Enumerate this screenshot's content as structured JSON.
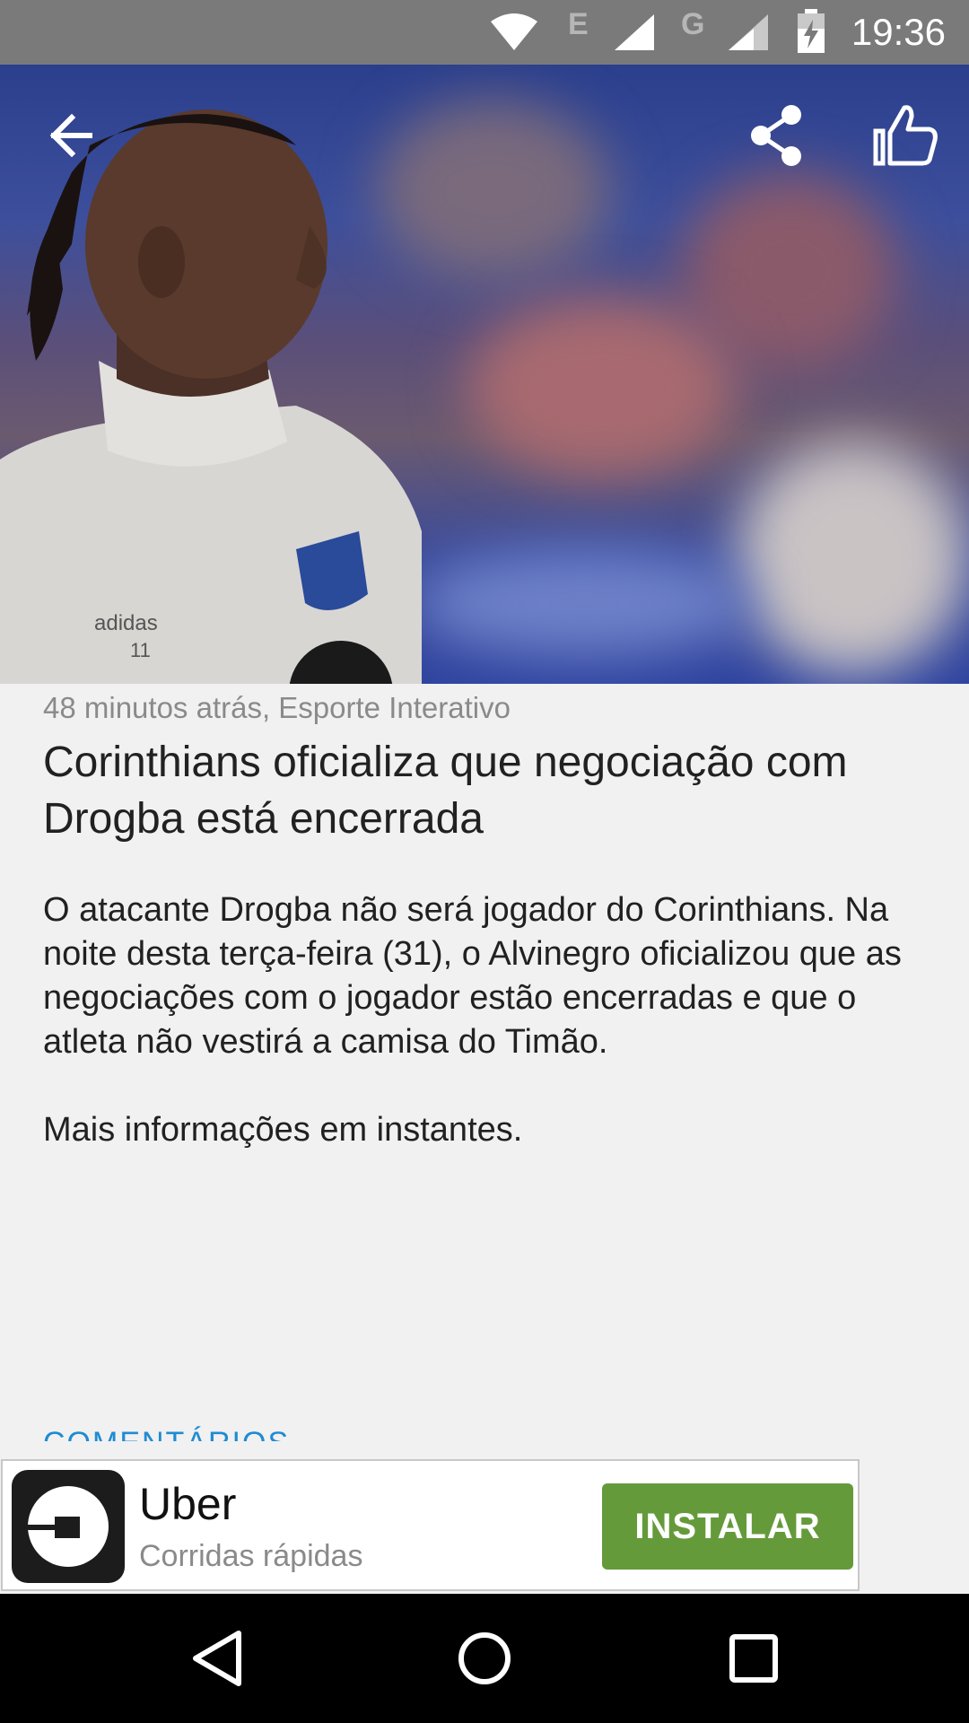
{
  "status_bar": {
    "time": "19:36",
    "network_letters": [
      "E",
      "G"
    ],
    "icons": [
      "wifi-icon",
      "signal-icon",
      "battery-charging-icon"
    ]
  },
  "hero": {
    "icons": [
      "back-arrow-icon",
      "share-icon",
      "thumbs-up-icon"
    ],
    "jersey_text": "adidas",
    "jersey_number": "11"
  },
  "article": {
    "meta": "48 minutos atrás, Esporte Interativo",
    "title": "Corinthians oficializa que negociação com Drogba está encerrada",
    "paragraphs": [
      "O atacante Drogba não será jogador do Corinthians. Na noite desta terça-feira (31), o Alvinegro oficializou que as negociações com o jogador estão encerradas e que o atleta não vestirá a camisa do Timão.",
      "Mais informações em instantes."
    ],
    "comments_label": "COMENTÁRIOS"
  },
  "ad": {
    "app_name": "Uber",
    "tagline": "Corridas rápidas",
    "install_label": "INSTALAR",
    "button_color": "#659a3a"
  },
  "nav_bar": {
    "icons": [
      "back-triangle-icon",
      "home-circle-icon",
      "recents-square-icon"
    ]
  }
}
